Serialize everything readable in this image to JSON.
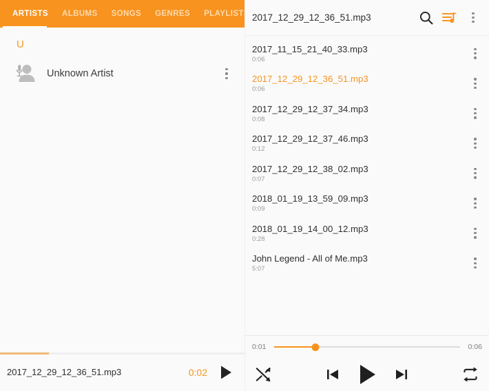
{
  "accent_color": "#F7931E",
  "background_color": "#FAFAFA",
  "tabs": [
    {
      "label": "ARTISTS",
      "active": true
    },
    {
      "label": "ALBUMS",
      "active": false
    },
    {
      "label": "SONGS",
      "active": false
    },
    {
      "label": "GENRES",
      "active": false
    },
    {
      "label": "PLAYLISTS",
      "active": false
    }
  ],
  "artists_panel": {
    "section_header": "U",
    "rows": [
      {
        "name": "Unknown Artist",
        "icon": "artist-microphone-icon"
      }
    ],
    "row_menu_icon": "overflow-menu-icon"
  },
  "mini_player": {
    "track_title": "2017_12_29_12_36_51.mp3",
    "elapsed": "0:02",
    "play_icon": "play-icon",
    "progress_percent": 20
  },
  "queue_header": {
    "title": "2017_12_29_12_36_51.mp3",
    "search_icon": "search-icon",
    "queue_icon": "playlist-queue-icon",
    "overflow_icon": "overflow-menu-icon"
  },
  "tracks": [
    {
      "name": "2017_11_15_21_40_33.mp3",
      "duration": "0:06",
      "playing": false
    },
    {
      "name": "2017_12_29_12_36_51.mp3",
      "duration": "0:06",
      "playing": true
    },
    {
      "name": "2017_12_29_12_37_34.mp3",
      "duration": "0:08",
      "playing": false
    },
    {
      "name": "2017_12_29_12_37_46.mp3",
      "duration": "0:12",
      "playing": false
    },
    {
      "name": "2017_12_29_12_38_02.mp3",
      "duration": "0:07",
      "playing": false
    },
    {
      "name": "2018_01_19_13_59_09.mp3",
      "duration": "0:09",
      "playing": false
    },
    {
      "name": "2018_01_19_14_00_12.mp3",
      "duration": "0:28",
      "playing": false
    },
    {
      "name": "John Legend - All of Me.mp3",
      "duration": "5:07",
      "playing": false
    }
  ],
  "player_controls": {
    "elapsed": "0:01",
    "total": "0:06",
    "progress_percent": 22,
    "shuffle_icon": "shuffle-icon",
    "previous_icon": "skip-previous-icon",
    "play_icon": "play-icon",
    "next_icon": "skip-next-icon",
    "repeat_icon": "repeat-icon"
  }
}
